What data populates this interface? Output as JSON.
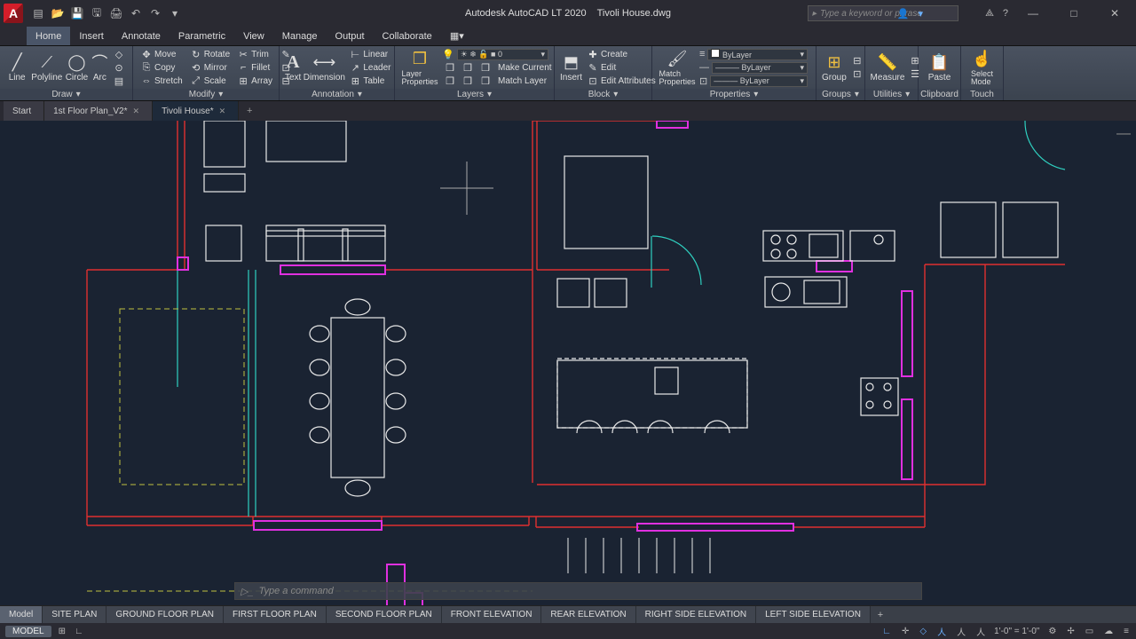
{
  "title": {
    "app": "Autodesk AutoCAD LT 2020",
    "file": "Tivoli House.dwg"
  },
  "search_placeholder": "Type a keyword or phrase",
  "menu_tabs": [
    "Home",
    "Insert",
    "Annotate",
    "Parametric",
    "View",
    "Manage",
    "Output",
    "Collaborate"
  ],
  "menu_active": 0,
  "ribbon": {
    "draw": {
      "title": "Draw",
      "items": [
        "Line",
        "Polyline",
        "Circle",
        "Arc"
      ]
    },
    "modify": {
      "title": "Modify",
      "rows": [
        [
          "Move",
          "Rotate",
          "Trim"
        ],
        [
          "Copy",
          "Mirror",
          "Fillet"
        ],
        [
          "Stretch",
          "Scale",
          "Array"
        ]
      ]
    },
    "annotation": {
      "title": "Annotation",
      "text": "Text",
      "dim": "Dimension",
      "items": [
        "Linear",
        "Leader",
        "Table"
      ]
    },
    "layers": {
      "title": "Layers",
      "btn": "Layer\nProperties",
      "current": "0",
      "items": [
        "Make Current",
        "Edit",
        "Edit Attributes"
      ],
      "extra": "Match Layer"
    },
    "block": {
      "title": "Block",
      "insert": "Insert",
      "items": [
        "Create",
        "Edit",
        "Edit Attributes"
      ]
    },
    "properties": {
      "title": "Properties",
      "match": "Match\nProperties",
      "layer": "ByLayer"
    },
    "groups": {
      "title": "Groups",
      "btn": "Group"
    },
    "utilities": {
      "title": "Utilities",
      "btn": "Measure"
    },
    "clipboard": {
      "title": "Clipboard",
      "btn": "Paste"
    },
    "touch": {
      "title": "Touch",
      "btn": "Select\nMode"
    }
  },
  "file_tabs": [
    {
      "label": "Start",
      "close": false
    },
    {
      "label": "1st Floor Plan_V2*",
      "close": true
    },
    {
      "label": "Tivoli House*",
      "close": true
    }
  ],
  "file_active": 2,
  "command_placeholder": "Type a command",
  "layout_tabs": [
    "Model",
    "SITE PLAN",
    "GROUND FLOOR PLAN",
    "FIRST FLOOR PLAN",
    "SECOND FLOOR PLAN",
    "FRONT  ELEVATION",
    "REAR  ELEVATION",
    "RIGHT SIDE ELEVATION",
    "LEFT SIDE  ELEVATION"
  ],
  "layout_active": 0,
  "status": {
    "model": "MODEL",
    "scale": "1'-0\" = 1'-0\""
  }
}
